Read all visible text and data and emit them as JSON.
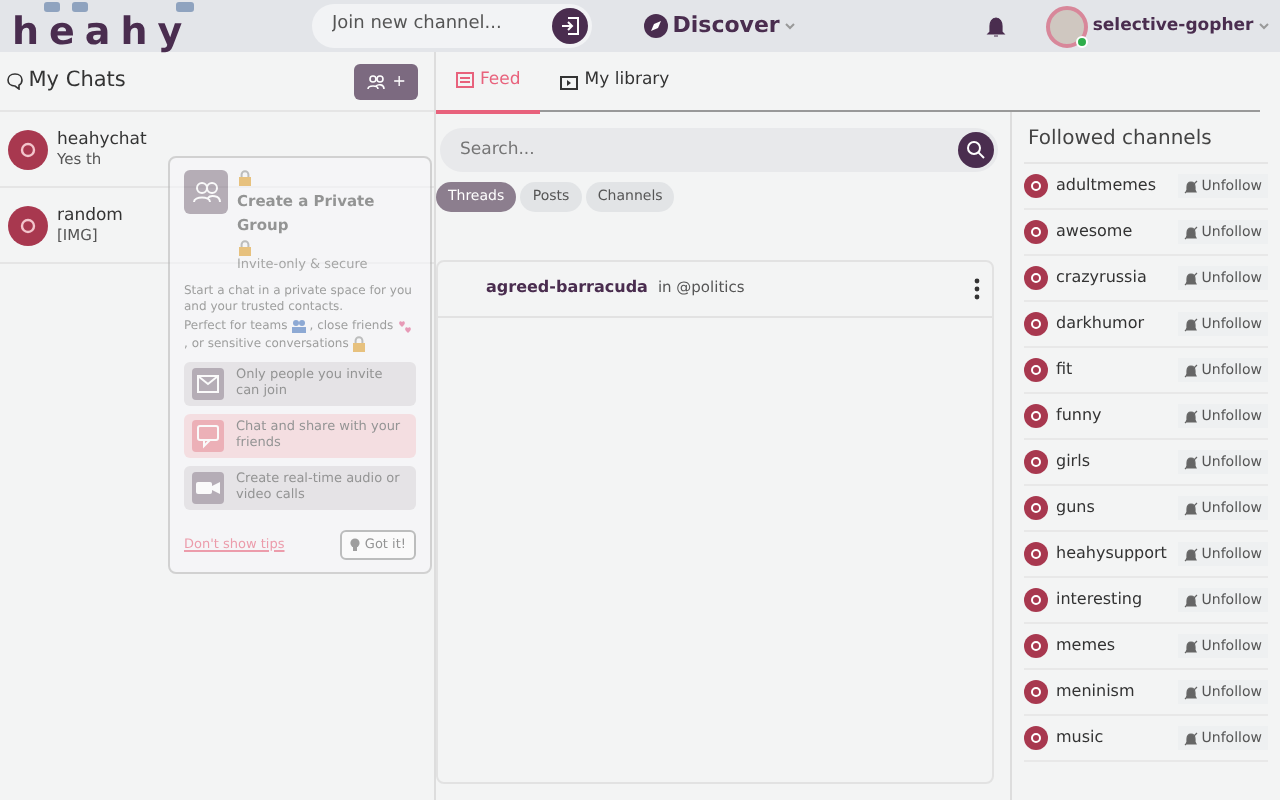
{
  "header": {
    "logo": "heahy",
    "join_placeholder": "Join new channel...",
    "nav_label": "Discover",
    "username": "selective-gopher",
    "online": true
  },
  "chats": {
    "title": "My Chats",
    "items": [
      {
        "name": "heahychat",
        "preview": "Yes th"
      },
      {
        "name": "random",
        "preview": "[IMG]"
      }
    ]
  },
  "tabs": [
    {
      "label": "Feed",
      "selected": true
    },
    {
      "label": "My library",
      "selected": false
    }
  ],
  "search": {
    "placeholder": "Search..."
  },
  "filters": [
    {
      "label": "Threads",
      "selected": true
    },
    {
      "label": "Posts",
      "selected": false
    },
    {
      "label": "Channels",
      "selected": false
    }
  ],
  "post": {
    "author": "agreed-barracuda",
    "joiner": "in",
    "channel": "@politics"
  },
  "followed": {
    "title": "Followed channels",
    "items": [
      {
        "name": "adultmemes",
        "action": "Unfollow"
      },
      {
        "name": "awesome",
        "action": "Unfollow"
      },
      {
        "name": "crazyrussia",
        "action": "Unfollow"
      },
      {
        "name": "darkhumor",
        "action": "Unfollow"
      },
      {
        "name": "fit",
        "action": "Unfollow"
      },
      {
        "name": "funny",
        "action": "Unfollow"
      },
      {
        "name": "girls",
        "action": "Unfollow"
      },
      {
        "name": "guns",
        "action": "Unfollow"
      },
      {
        "name": "heahysupport",
        "action": "Unfollow"
      },
      {
        "name": "interesting",
        "action": "Unfollow"
      },
      {
        "name": "memes",
        "action": "Unfollow"
      },
      {
        "name": "meninism",
        "action": "Unfollow"
      },
      {
        "name": "music",
        "action": "Unfollow"
      }
    ]
  },
  "tip": {
    "button_label": "+",
    "title": "Create a Private Group",
    "subtitle": "Invite-only & secure",
    "description": [
      {
        "text": "Start a chat in a private space for you and your trusted contacts.",
        "kind": "plain"
      },
      {
        "text": "Perfect for teams",
        "kind": "people"
      },
      {
        "text": ", close friends",
        "kind": "hearts"
      },
      {
        "text": ", or sensitive conversations",
        "kind": "lock"
      }
    ],
    "features": [
      {
        "kind": "invite",
        "text": "Only people you invite can join",
        "highlighted": false
      },
      {
        "kind": "chat",
        "text": "Chat and share with your friends",
        "highlighted": true
      },
      {
        "kind": "video",
        "text": "Create real-time audio or video calls",
        "highlighted": false
      }
    ],
    "dismiss": "Don't show tips",
    "confirm": "Got it!"
  }
}
